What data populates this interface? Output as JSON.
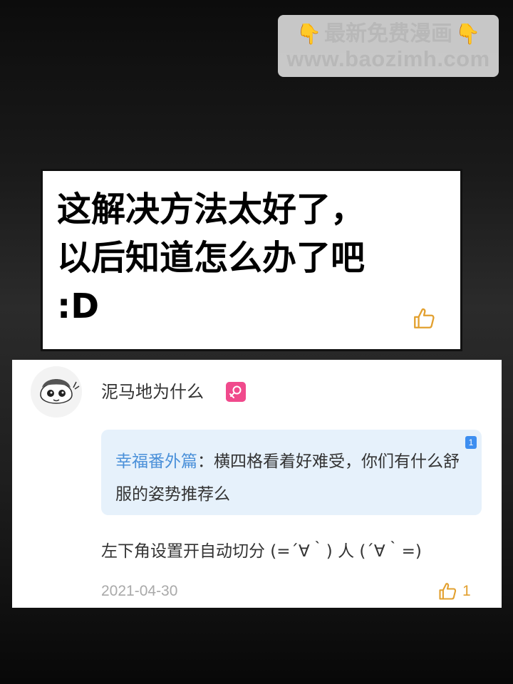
{
  "watermark": {
    "line1": "最新免费漫画",
    "line2": "www.baozimh.com",
    "icon_left": "pointing-down-hand-icon",
    "icon_right": "pointing-down-hand-icon"
  },
  "speech_panel": {
    "text": "这解决方法太好了，\n以后知道怎么办了吧\n:D",
    "like_icon": "thumbs-up-icon"
  },
  "comment": {
    "username": "泥马地为什么",
    "gender_icon": "female-symbol-icon",
    "quote": {
      "user": "幸福番外篇",
      "separator": "：",
      "text": "横四格看着好难受，你们有什么舒服的姿势推荐么",
      "badge": "1"
    },
    "reply": "左下角设置开自动切分 (=´∀｀) 人 (´∀｀=)",
    "date": "2021-04-30",
    "likes": "1",
    "like_icon": "thumbs-up-icon"
  },
  "colors": {
    "watermark_bg": "#f0f0f0",
    "watermark_text": "#b8b8b8",
    "gender_badge": "#f04a8c",
    "quote_bg": "#e6f1fb",
    "quote_user": "#4a90d9",
    "quote_badge": "#3d8ef0",
    "like_accent": "#e2a02f",
    "date_text": "#a9a9a9"
  }
}
